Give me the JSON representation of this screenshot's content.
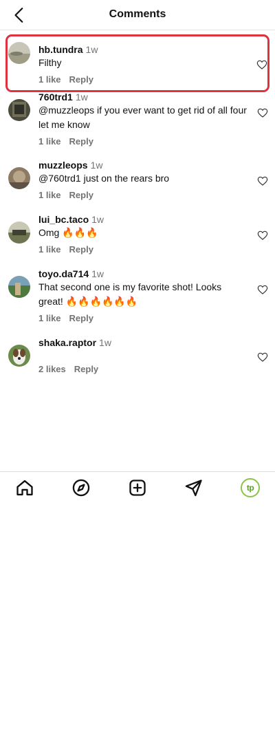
{
  "header": {
    "title": "Comments"
  },
  "comments": [
    {
      "username": "hb.tundra",
      "time": "1w",
      "text": "Filthy",
      "likes": "1 like",
      "reply": "Reply"
    },
    {
      "username": "760trd1",
      "time": "1w",
      "text": "@muzzleops if you ever want to get rid of all four let me know",
      "likes": "1 like",
      "reply": "Reply"
    },
    {
      "username": "muzzleops",
      "time": "1w",
      "text": "@760trd1 just on the rears bro",
      "likes": "1 like",
      "reply": "Reply"
    },
    {
      "username": "lui_bc.taco",
      "time": "1w",
      "text": "Omg 🔥🔥🔥",
      "likes": "1 like",
      "reply": "Reply"
    },
    {
      "username": "toyo.da714",
      "time": "1w",
      "text": "That second one is my favorite shot! Looks great! 🔥🔥🔥🔥🔥🔥",
      "likes": "1 like",
      "reply": "Reply"
    },
    {
      "username": "shaka.raptor",
      "time": "1w",
      "text": "",
      "likes": "2 likes",
      "reply": "Reply"
    }
  ],
  "nav": {
    "items": [
      "home-icon",
      "explore-icon",
      "create-icon",
      "messages-icon",
      "profile-icon"
    ],
    "profile_initials": "tp"
  },
  "colors": {
    "highlight": "#e0313e",
    "profile_accent": "#8bc34a",
    "meta_gray": "#737373"
  }
}
